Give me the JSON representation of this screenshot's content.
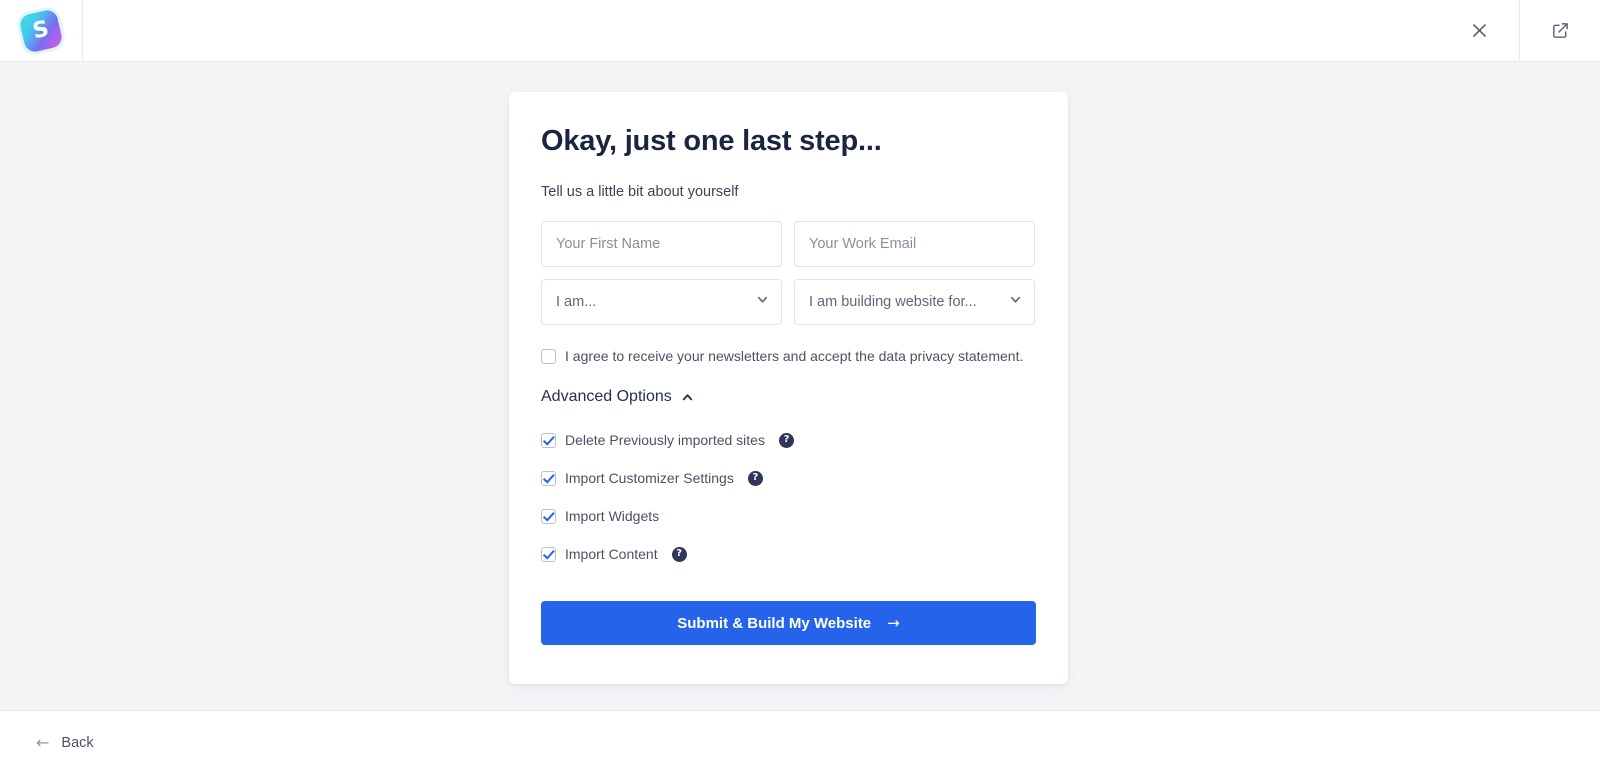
{
  "header": {
    "logo_glyph": "S",
    "logo_name": "starter-templates-logo",
    "close_label": "×",
    "external_link_label": "↗"
  },
  "card": {
    "title": "Okay, just one last step...",
    "subtitle": "Tell us a little bit about yourself",
    "fields": {
      "first_name": {
        "placeholder": "Your First Name",
        "value": ""
      },
      "work_email": {
        "placeholder": "Your Work Email",
        "value": ""
      },
      "i_am": {
        "selected": "I am...",
        "options": [
          "I am..."
        ]
      },
      "building_for": {
        "selected": "I am building website for...",
        "options": [
          "I am building website for..."
        ]
      }
    },
    "consent": {
      "label": "I agree to receive your newsletters and accept the data privacy statement.",
      "checked": false
    },
    "advanced": {
      "title": "Advanced Options",
      "expanded": true,
      "caret": "chevron-up",
      "items": [
        {
          "label": "Delete Previously imported sites",
          "checked": true,
          "has_help": true
        },
        {
          "label": "Import Customizer Settings",
          "checked": true,
          "has_help": true
        },
        {
          "label": "Import Widgets",
          "checked": true,
          "has_help": false
        },
        {
          "label": "Import Content",
          "checked": true,
          "has_help": true
        }
      ],
      "help_glyph": "?"
    },
    "submit": {
      "label": "Submit & Build My Website",
      "arrow": "→",
      "color": "#2563eb"
    }
  },
  "footer": {
    "back_label": "Back",
    "back_arrow": "←"
  }
}
